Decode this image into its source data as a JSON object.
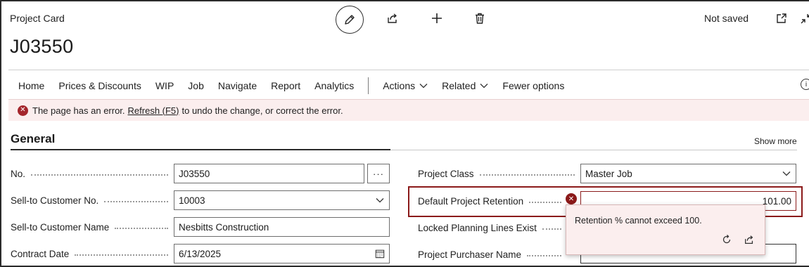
{
  "header": {
    "card_title": "Project Card",
    "record_id": "J03550",
    "status": "Not saved"
  },
  "toolbar": {
    "icons": [
      "pencil-icon",
      "share-icon",
      "plus-icon",
      "trash-icon",
      "open-new-window-icon",
      "collapse-icon"
    ]
  },
  "nav": {
    "items": [
      "Home",
      "Prices & Discounts",
      "WIP",
      "Job",
      "Navigate",
      "Report",
      "Analytics"
    ],
    "dropdowns": [
      "Actions",
      "Related"
    ],
    "fewer_options": "Fewer options"
  },
  "error_bar": {
    "prefix": "The page has an error.",
    "link": "Refresh (F5)",
    "suffix": "to undo the change, or correct the error."
  },
  "section": {
    "title": "General",
    "show_more": "Show more"
  },
  "fields_left": [
    {
      "label": "No.",
      "value": "J03550"
    },
    {
      "label": "Sell-to Customer No.",
      "value": "10003"
    },
    {
      "label": "Sell-to Customer Name",
      "value": "Nesbitts Construction"
    },
    {
      "label": "Contract Date",
      "value": "6/13/2025"
    }
  ],
  "fields_right": [
    {
      "label": "Project Class",
      "value": "Master Job"
    },
    {
      "label": "Default Project Retention",
      "value": "101.00"
    },
    {
      "label": "Locked Planning Lines Exist",
      "value": ""
    },
    {
      "label": "Project Purchaser Name",
      "value": ""
    }
  ],
  "validation_popup": {
    "message": "Retention % cannot exceed 100."
  },
  "colors": {
    "error_red": "#a4262c",
    "error_bg": "#fbeeee",
    "highlight_border": "#8b1a1a"
  }
}
